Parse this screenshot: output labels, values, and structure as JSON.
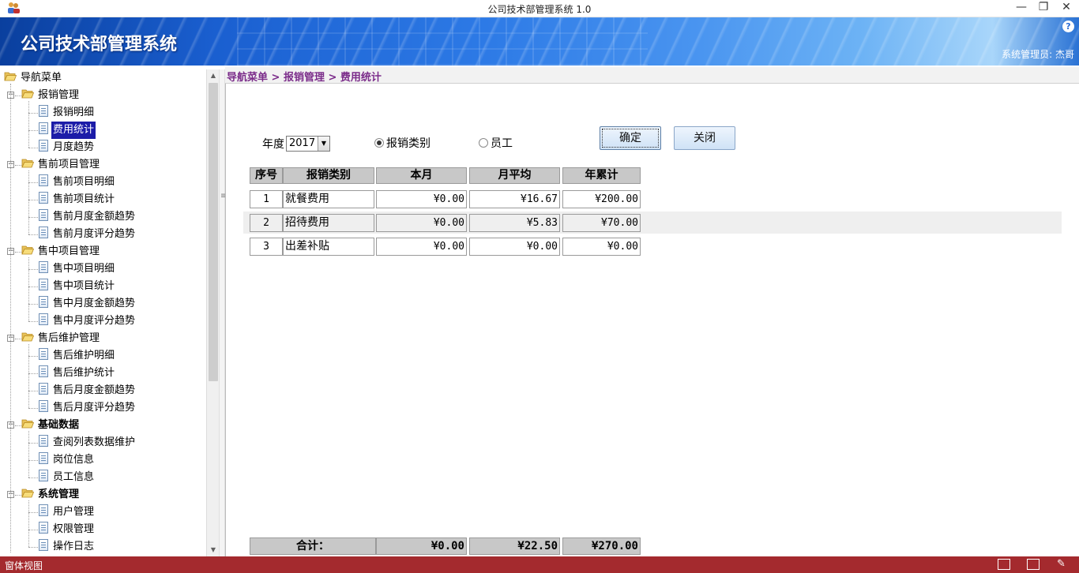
{
  "window": {
    "title": "公司技术部管理系统 1.0",
    "minimize": "—",
    "restore": "❐",
    "close": "✕"
  },
  "banner": {
    "title": "公司技术部管理系统",
    "admin": "系统管理员: 杰哥",
    "help": "?"
  },
  "nav": {
    "root": "导航菜单",
    "groups": [
      {
        "label": "报销管理",
        "items": [
          "报销明细",
          "费用统计",
          "月度趋势"
        ]
      },
      {
        "label": "售前项目管理",
        "items": [
          "售前项目明细",
          "售前项目统计",
          "售前月度金额趋势",
          "售前月度评分趋势"
        ]
      },
      {
        "label": "售中项目管理",
        "items": [
          "售中项目明细",
          "售中项目统计",
          "售中月度金额趋势",
          "售中月度评分趋势"
        ]
      },
      {
        "label": "售后维护管理",
        "items": [
          "售后维护明细",
          "售后维护统计",
          "售后月度金额趋势",
          "售后月度评分趋势"
        ]
      },
      {
        "label": "基础数据",
        "items": [
          "查阅列表数据维护",
          "岗位信息",
          "员工信息"
        ]
      },
      {
        "label": "系统管理",
        "items": [
          "用户管理",
          "权限管理",
          "操作日志"
        ]
      }
    ],
    "selected": "费用统计"
  },
  "breadcrumb": "导航菜单 > 报销管理 > 费用统计",
  "filters": {
    "year_label": "年度",
    "year_value": "2017",
    "radio_category": "报销类别",
    "radio_employee": "员工",
    "selected_radio": "报销类别"
  },
  "buttons": {
    "confirm": "确定",
    "close": "关闭"
  },
  "table": {
    "headers": [
      "序号",
      "报销类别",
      "本月",
      "月平均",
      "年累计"
    ],
    "rows": [
      [
        "1",
        "就餐费用",
        "¥0.00",
        "¥16.67",
        "¥200.00"
      ],
      [
        "2",
        "招待费用",
        "¥0.00",
        "¥5.83",
        "¥70.00"
      ],
      [
        "3",
        "出差补贴",
        "¥0.00",
        "¥0.00",
        "¥0.00"
      ]
    ],
    "total_label": "合计：",
    "totals": [
      "¥0.00",
      "¥22.50",
      "¥270.00"
    ]
  },
  "statusbar": {
    "text": "窗体视图"
  }
}
